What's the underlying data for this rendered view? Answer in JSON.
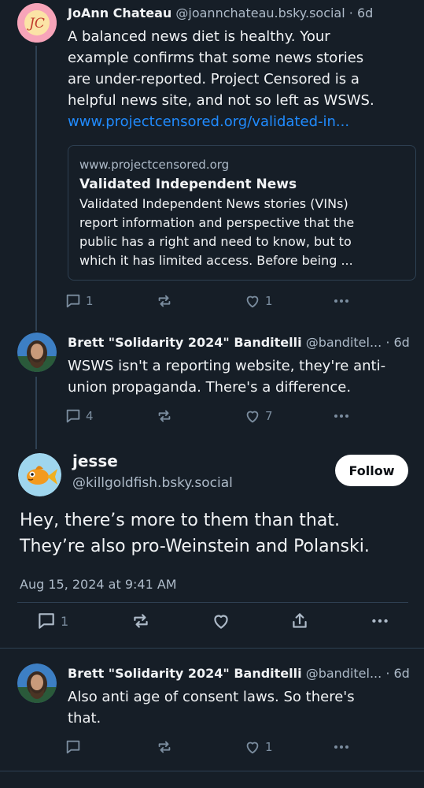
{
  "colors": {
    "background": "#161e27",
    "link": "#208bfe",
    "muted": "#aebbc9",
    "icon": "#7b8d9f",
    "thread_line": "#2e4052"
  },
  "posts": [
    {
      "author_name": "JoAnn Chateau",
      "handle": "@joannchateau.bsky.social",
      "time": "· 6d",
      "avatar_initials": "JC",
      "text_lines": [
        "A balanced news diet is healthy. Your",
        "example confirms that some news stories",
        "are under-reported. Project Censored is a",
        "helpful news site, and not so left as WSWS."
      ],
      "link_text": "www.projectcensored.org/validated-in...",
      "embed": {
        "domain": "www.projectcensored.org",
        "title": "Validated Independent News",
        "description_lines": [
          "Validated Independent News stories (VINs)",
          "report information and perspective that the",
          "public has a right and need to know, but to",
          "which it has limited access. Before being ..."
        ]
      },
      "reply_count": "1",
      "repost_count": "",
      "like_count": "1"
    },
    {
      "author_name": "Brett \"Solidarity 2024\" Banditelli",
      "handle": "@banditel...",
      "time": "· 6d",
      "text_lines": [
        "WSWS isn't a reporting website, they're anti-",
        "union propaganda. There's a difference."
      ],
      "reply_count": "4",
      "repost_count": "",
      "like_count": "7"
    }
  ],
  "main_post": {
    "author_name": "jesse",
    "handle": "@killgoldfish.bsky.social",
    "follow_label": "Follow",
    "text_lines": [
      "Hey, there’s more to them than that.",
      "They’re also pro-Weinstein and Polanski."
    ],
    "date": "Aug 15, 2024 at 9:41 AM",
    "reply_count": "1"
  },
  "reply": {
    "author_name": "Brett \"Solidarity 2024\" Banditelli",
    "handle": "@banditel...",
    "time": "· 6d",
    "text_lines": [
      "Also anti age of consent laws. So there's",
      "that."
    ],
    "reply_count": "",
    "like_count": "1"
  },
  "icons": [
    "reply-icon",
    "repost-icon",
    "like-icon",
    "share-icon",
    "more-icon"
  ]
}
